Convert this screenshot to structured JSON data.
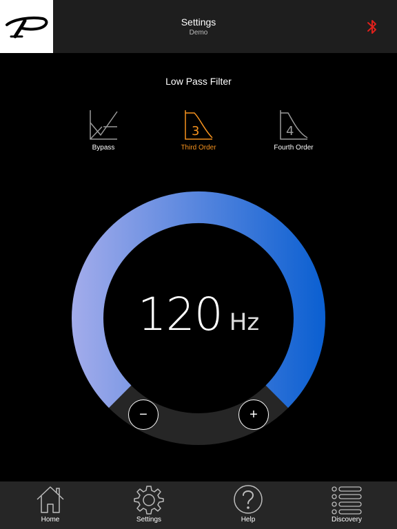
{
  "header": {
    "title": "Settings",
    "subtitle": "Demo",
    "logo_icon": "brand-p-logo",
    "bluetooth_icon": "bluetooth-icon",
    "bluetooth_color": "#e0201b"
  },
  "filter": {
    "section_title": "Low Pass Filter",
    "options": [
      {
        "label": "Bypass",
        "icon": "bypass-filter-icon",
        "selected": false
      },
      {
        "label": "Third Order",
        "icon": "third-order-filter-icon",
        "glyph": "3",
        "selected": true
      },
      {
        "label": "Fourth Order",
        "icon": "fourth-order-filter-icon",
        "glyph": "4",
        "selected": false
      }
    ],
    "active_color": "#f7931e"
  },
  "dial": {
    "value": "120",
    "unit": "Hz",
    "minus_label": "−",
    "plus_label": "+",
    "gradient_start": "#a3aceb",
    "gradient_end": "#0a5fd1"
  },
  "nav": {
    "items": [
      {
        "label": "Home",
        "icon": "home-icon"
      },
      {
        "label": "Settings",
        "icon": "gear-icon"
      },
      {
        "label": "Help",
        "icon": "help-icon"
      },
      {
        "label": "Discovery",
        "icon": "list-icon"
      }
    ]
  }
}
